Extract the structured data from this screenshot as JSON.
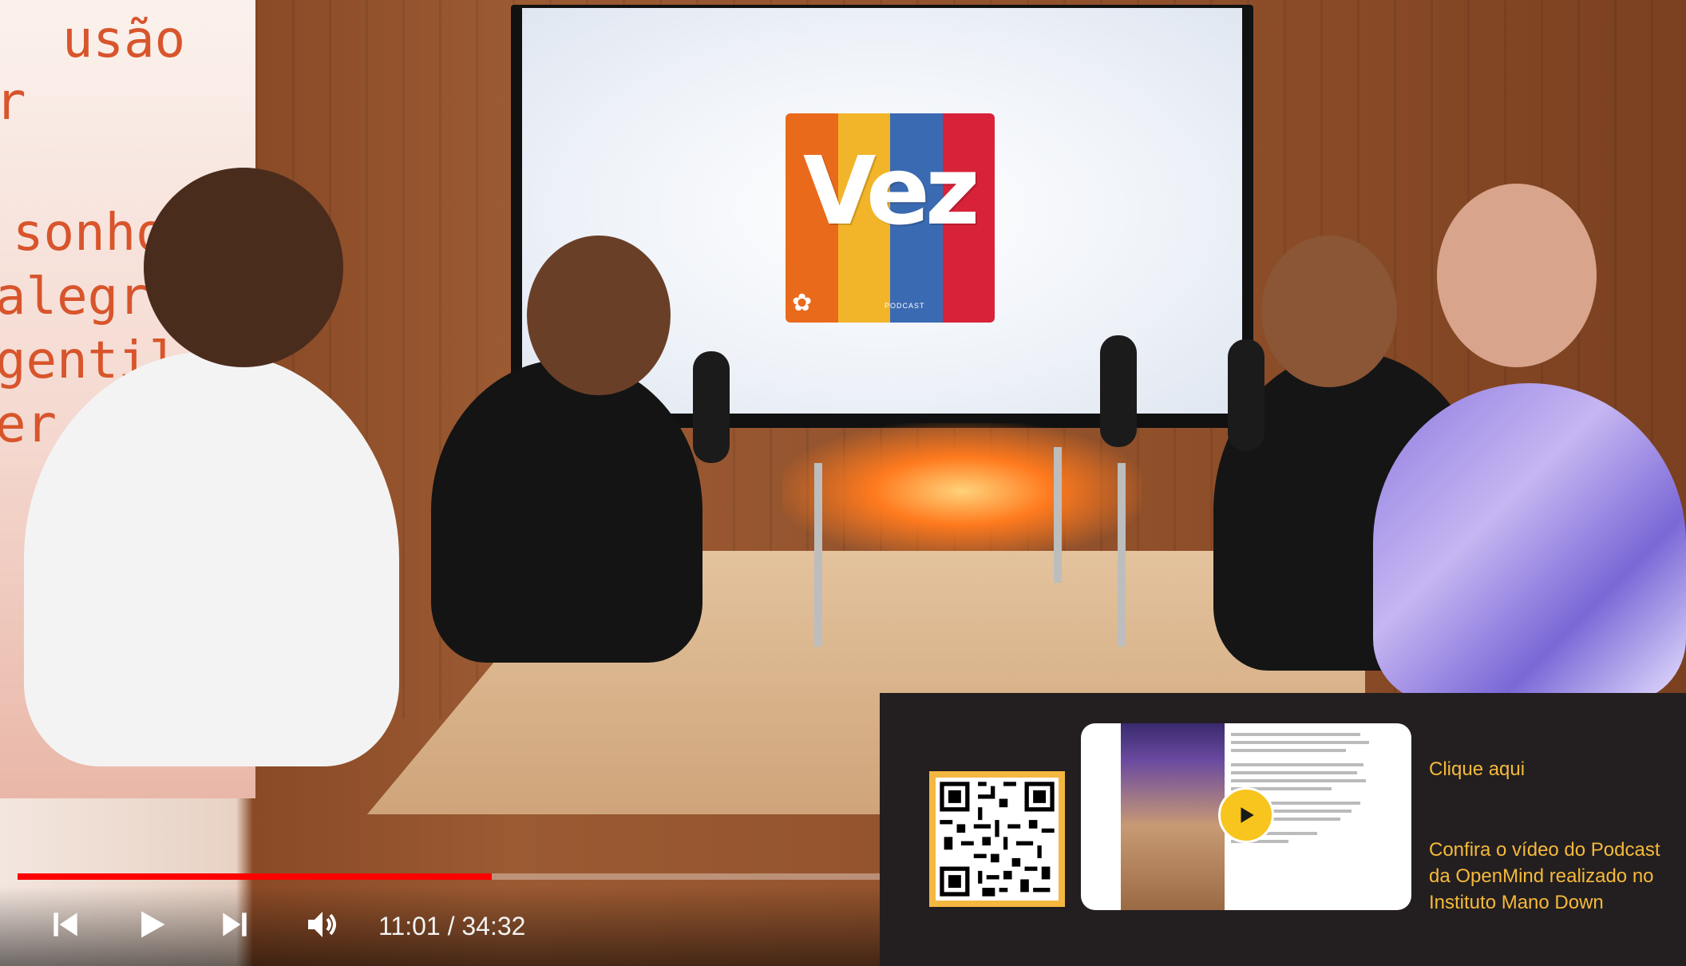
{
  "video": {
    "wall_text_lines": [
      "usão",
      "r",
      "sonhos",
      "alegr`a",
      "gentil",
      "er"
    ],
    "logo_text": "Vez",
    "logo_subtext": "PODCAST",
    "logo_colors": [
      "#ea6a1c",
      "#f2b52a",
      "#3a6ab2",
      "#d8223a"
    ]
  },
  "player": {
    "progress_fraction": 0.55,
    "time_current": "11:01",
    "time_separator": "/",
    "time_total": "34:32",
    "icons": {
      "previous": "skip-previous-icon",
      "play": "play-icon",
      "next": "skip-next-icon",
      "volume": "volume-icon"
    },
    "accent_color": "#ff0000"
  },
  "promo": {
    "link_label": "Clique aqui",
    "description": "Confira o vídeo do Podcast da OpenMind realizado no Instituto Mano Down",
    "accent_color": "#f6b93b",
    "background_color": "#231f20"
  }
}
